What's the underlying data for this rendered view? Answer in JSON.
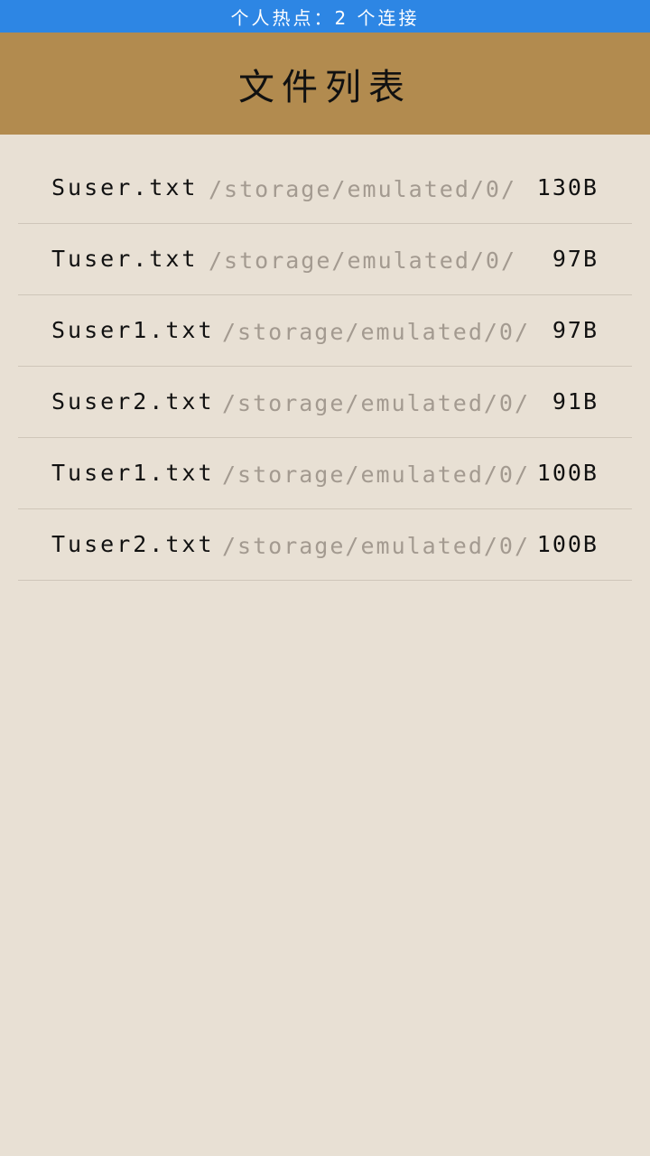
{
  "status_bar": {
    "text": "个人热点：2 个连接"
  },
  "header": {
    "title": "文件列表"
  },
  "files": [
    {
      "name": "Suser.txt",
      "path": "/storage/emulated/0/",
      "size": "130B"
    },
    {
      "name": "Tuser.txt",
      "path": "/storage/emulated/0/",
      "size": "97B"
    },
    {
      "name": "Suser1.txt",
      "path": "/storage/emulated/0/",
      "size": "97B"
    },
    {
      "name": "Suser2.txt",
      "path": "/storage/emulated/0/",
      "size": "91B"
    },
    {
      "name": "Tuser1.txt",
      "path": "/storage/emulated/0/",
      "size": "100B"
    },
    {
      "name": "Tuser2.txt",
      "path": "/storage/emulated/0/",
      "size": "100B"
    }
  ],
  "colors": {
    "status_bar_bg": "#2d86e4",
    "header_bg": "#b28b4f",
    "page_bg": "#e8e0d4",
    "path_text": "#a39a90",
    "divider": "#cfc6b9"
  }
}
